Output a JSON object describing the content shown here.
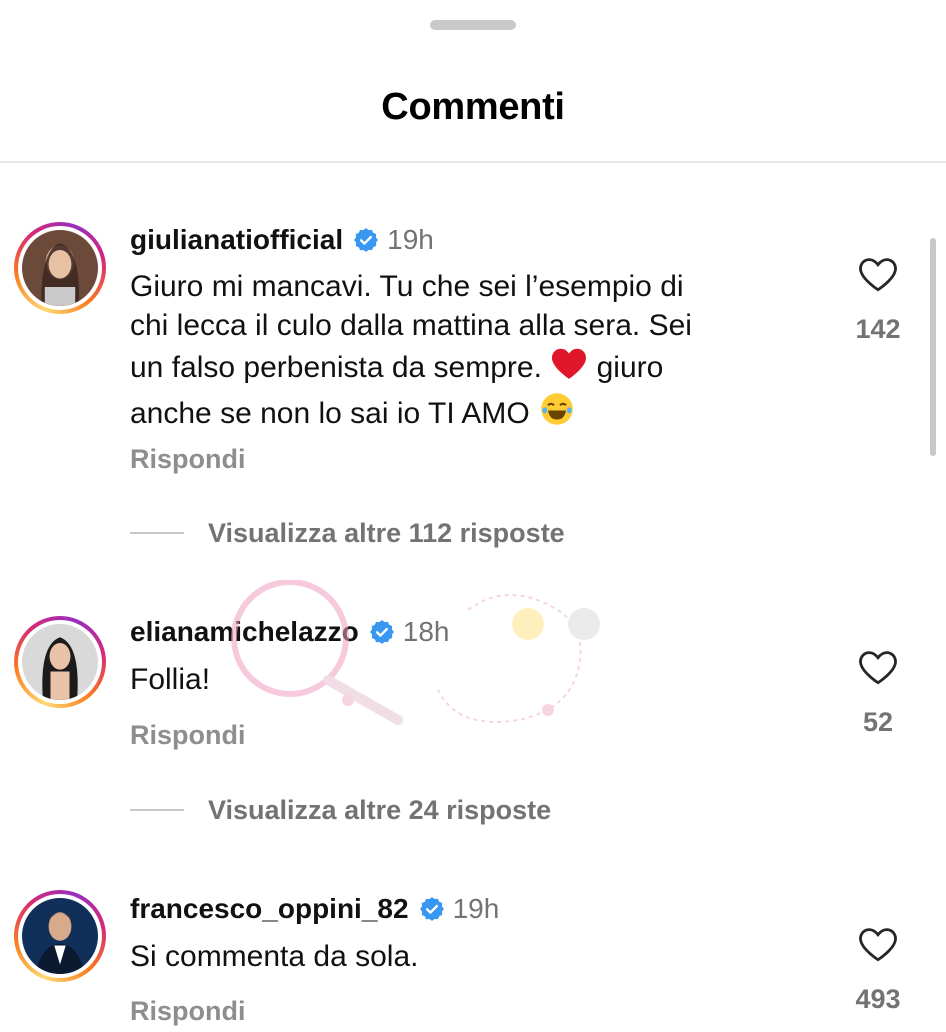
{
  "header": {
    "title": "Commenti"
  },
  "comments": [
    {
      "username": "giulianatiofficial",
      "verified": true,
      "time": "19h",
      "text_line1": "Giuro mi mancavi. Tu che sei l’esempio di",
      "text_line2": "chi lecca il culo dalla mattina alla sera. Sei",
      "text_line3": "un falso perbenista da sempre.",
      "text_line3_after": " giuro",
      "text_line4": "anche se non lo sai io TI AMO",
      "emoji_1": "red-heart",
      "emoji_2": "tears-of-joy",
      "reply_label": "Rispondi",
      "likes": "142",
      "view_replies": "Visualizza altre 112 risposte"
    },
    {
      "username": "elianamichelazzo",
      "verified": true,
      "time": "18h",
      "text": "Follia!",
      "reply_label": "Rispondi",
      "likes": "52",
      "view_replies": "Visualizza altre 24 risposte"
    },
    {
      "username": "francesco_oppini_82",
      "verified": true,
      "time": "19h",
      "text": "Si commenta da sola.",
      "reply_label": "Rispondi",
      "likes": "493"
    }
  ],
  "colors": {
    "verified_blue": "#3897f0",
    "muted_text": "#737373",
    "reply_text": "#8e8e8e",
    "heart_red": "#e0162b"
  }
}
